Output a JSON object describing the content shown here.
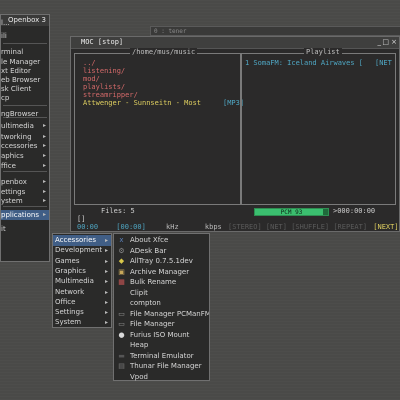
{
  "openbox_menu": {
    "title": "Openbox 3",
    "items": [
      {
        "label": "l...",
        "has_sub": false
      },
      {
        "label": "ili",
        "has_sub": false
      },
      {
        "label": "rminal",
        "has_sub": false
      },
      {
        "label": "le Manager",
        "has_sub": false
      },
      {
        "label": "xt Editor",
        "has_sub": false
      },
      {
        "label": "eb Browser",
        "has_sub": false
      },
      {
        "label": "sk Client",
        "has_sub": false
      },
      {
        "label": "cp",
        "has_sub": false
      },
      {
        "label": "ngBrowser",
        "has_sub": false
      },
      {
        "label": "ultimedia",
        "has_sub": true
      },
      {
        "label": "tworking",
        "has_sub": true
      },
      {
        "label": "ccessories",
        "has_sub": true
      },
      {
        "label": "aphics",
        "has_sub": true
      },
      {
        "label": "ffice",
        "has_sub": true
      },
      {
        "label": "penbox",
        "has_sub": true
      },
      {
        "label": "ettings",
        "has_sub": true
      },
      {
        "label": "ystem",
        "has_sub": true
      },
      {
        "label": "pplications",
        "has_sub": true
      },
      {
        "label": "it",
        "has_sub": false
      }
    ]
  },
  "bg_terminal": {
    "title": "0 : tener"
  },
  "moc": {
    "title": "MOC [stop]",
    "controls": {
      "min": "_",
      "max": "□",
      "close": "×"
    },
    "file_pane_header": "/home/mus/music",
    "playlist_header": "Playlist",
    "files": [
      {
        "name": "../",
        "type": "dir"
      },
      {
        "name": "listening/",
        "type": "dir"
      },
      {
        "name": "mod/",
        "type": "dir"
      },
      {
        "name": "playlists/",
        "type": "dir"
      },
      {
        "name": "streamripper/",
        "type": "dir"
      },
      {
        "name": "Attwenger - Sunnseitn - Most",
        "type": "current",
        "tag": "[MP3]"
      }
    ],
    "playlist": [
      {
        "name": "1 SomaFM: Iceland Airwaves [",
        "tag": "[NET"
      }
    ],
    "files_count": "Files: 5",
    "pcm_label": "PCM",
    "pcm_value": "93",
    "pcm_level": 0.93,
    "time_right": ">000:00:00",
    "status_bracket": "[]",
    "time_pos": "00:00",
    "time_bracket_open": "[",
    "time_total": "00:00",
    "time_bracket_close": "]",
    "khz": "kHz",
    "kbps": "kbps",
    "flags": "[STEREO] [NET] [SHUFFLE] [REPEAT]",
    "next_flag": "[NEXT]"
  },
  "apps_menu": {
    "items": [
      {
        "label": "Accessories",
        "active": true
      },
      {
        "label": "Development"
      },
      {
        "label": "Games"
      },
      {
        "label": "Graphics"
      },
      {
        "label": "Multimedia"
      },
      {
        "label": "Network"
      },
      {
        "label": "Office"
      },
      {
        "label": "Settings"
      },
      {
        "label": "System"
      }
    ]
  },
  "accessories_menu": {
    "items": [
      {
        "label": "About Xfce",
        "icon": "xfce-icon",
        "color": "#5a7fb8",
        "glyph": "x"
      },
      {
        "label": "ADesk Bar",
        "icon": "gear-icon",
        "color": "#8a8a8a",
        "glyph": "⚙"
      },
      {
        "label": "AllTray 0.7.5.1dev",
        "icon": "tray-icon",
        "color": "#d9c84a",
        "glyph": "◆"
      },
      {
        "label": "Archive Manager",
        "icon": "archive-icon",
        "color": "#c8a85a",
        "glyph": "▣"
      },
      {
        "label": "Bulk Rename",
        "icon": "rename-icon",
        "color": "#c95656",
        "glyph": "▦"
      },
      {
        "label": "Clipit",
        "icon": "",
        "color": "",
        "glyph": ""
      },
      {
        "label": "compton",
        "icon": "",
        "color": "",
        "glyph": ""
      },
      {
        "label": "File Manager PCManFM",
        "icon": "folder-icon",
        "color": "#9a9a9a",
        "glyph": "▭"
      },
      {
        "label": "File Manager",
        "icon": "folder-icon",
        "color": "#9a9a9a",
        "glyph": "▭"
      },
      {
        "label": "Furius ISO Mount",
        "icon": "disc-icon",
        "color": "#d8d8d8",
        "glyph": "●"
      },
      {
        "label": "Heap",
        "icon": "",
        "color": "",
        "glyph": ""
      },
      {
        "label": "Terminal Emulator",
        "icon": "terminal-icon",
        "color": "#555555",
        "glyph": "▬"
      },
      {
        "label": "Thunar File Manager",
        "icon": "thunar-icon",
        "color": "#7a7a7a",
        "glyph": "▤"
      },
      {
        "label": "Vpod",
        "icon": "",
        "color": "",
        "glyph": ""
      }
    ]
  }
}
